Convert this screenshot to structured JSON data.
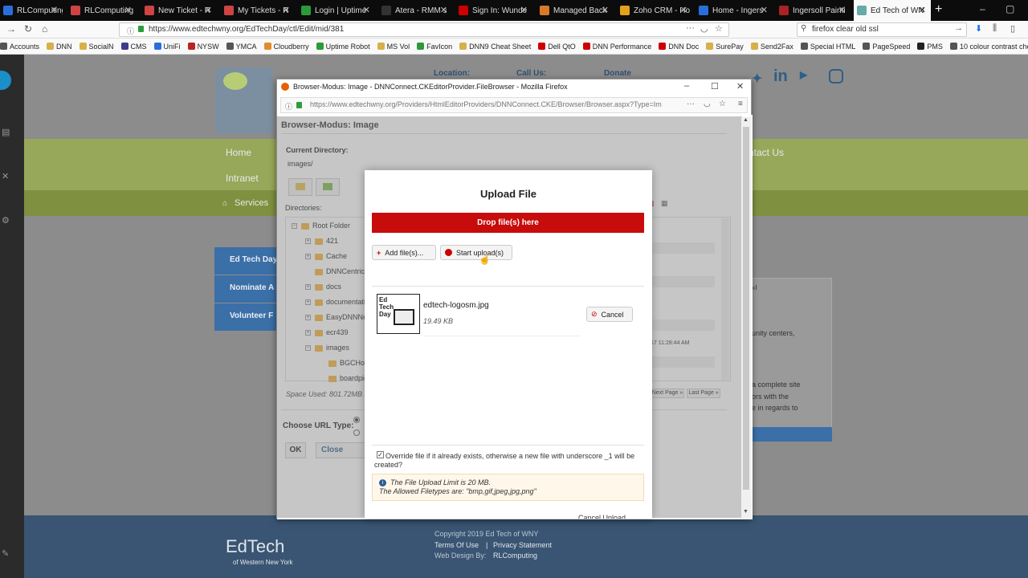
{
  "browser": {
    "tabs": [
      {
        "label": "RLComputing",
        "fav": "#2a6edb"
      },
      {
        "label": "RLComputing",
        "fav": "#c44"
      },
      {
        "label": "New Ticket - R",
        "fav": "#c44"
      },
      {
        "label": "My Tickets - R",
        "fav": "#c44"
      },
      {
        "label": "Login | Uptime",
        "fav": "#2b9b3a"
      },
      {
        "label": "Atera - RMM s",
        "fav": "#333"
      },
      {
        "label": "Sign In: Wunde",
        "fav": "#c00"
      },
      {
        "label": "Managed Back",
        "fav": "#d97a2b"
      },
      {
        "label": "Zoho CRM - Ho",
        "fav": "#e3a21a"
      },
      {
        "label": "Home - Ingers",
        "fav": "#2a6edb"
      },
      {
        "label": "Ingersoll Painti",
        "fav": "#a22"
      },
      {
        "label": "Ed Tech of WN",
        "fav": "#6aa"
      }
    ],
    "url": "https://www.edtechwny.org/EdTechDay/ctl/Edit/mid/381",
    "search": "firefox clear old ssl",
    "bookmarks": [
      "Accounts",
      "DNN",
      "SocialN",
      "CMS",
      "UniFi",
      "NYSW",
      "YMCA",
      "Cloudberry",
      "Uptime Robot",
      "MS Vol",
      "FavIcon",
      "DNN9 Cheat Sheet",
      "Dell QtO",
      "DNN Performance",
      "DNN Doc",
      "SurePay",
      "Send2Fax",
      "Special HTML",
      "PageSpeed",
      "PMS",
      "10 colour contrast che..."
    ]
  },
  "site": {
    "location_label": "Location:",
    "call_label": "Call Us:",
    "donate_label": "Donate",
    "nav_home": "Home",
    "nav_intranet": "Intranet",
    "nav_contact": "ntact Us",
    "services": "Services",
    "side_buttons": [
      "Ed Tech Day",
      "Nominate A",
      "Volunteer F"
    ],
    "side_text_1": "unity centers,",
    "side_text_2": "a complete site",
    "side_text_3": "ors with the",
    "side_text_4": "e in regards to",
    "footer_logo": "EdTech",
    "footer_logo_sub": "of Western New York",
    "copyright": "Copyright 2019 Ed Tech of WNY",
    "terms": "Terms Of Use",
    "privacy": "Privacy Statement",
    "web_design": "Web Design By:",
    "web_design_by": "RLComputing"
  },
  "popup": {
    "title": "Browser-Modus: Image - DNNConnect.CKEditorProvider.FileBrowser - Mozilla Firefox",
    "url": "https://www.edtechwny.org/Providers/HtmlEditorProviders/DNNConnect.CKE/Browser/Browser.aspx?Type=Im",
    "heading": "Browser-Modus: Image",
    "current_dir_label": "Current Directory:",
    "current_dir": "images/",
    "directories_label": "Directories:",
    "tree": [
      "Root Folder",
      "421",
      "Cache",
      "DNNCentric",
      "docs",
      "documentati",
      "EasyDNNNe",
      "ecr439",
      "images",
      "BGCHol",
      "boardpic"
    ],
    "space_used": "Space Used: 801.72MB c",
    "choose_url_label": "Choose URL Type:",
    "ok": "OK",
    "close_window": "Close Windo",
    "timestamp": "17 11:28:44 AM",
    "next_page": "Next Page »",
    "last_page": "Last Page »"
  },
  "upload": {
    "title": "Upload File",
    "drop": "Drop file(s) here",
    "add_files": "Add file(s)...",
    "start_upload": "Start upload(s)",
    "file_name": "edtech-logosm.jpg",
    "file_size": "19.49 KB",
    "thumb_text": "Ed Tech Day",
    "cancel": "Cancel",
    "override_text": "Override file if it already exists, otherwise a new file with underscore _1 will be created?",
    "limit_text": "The File Upload Limit is 20 MB.",
    "filetypes_text": "The Allowed Filetypes are: \"bmp,gif,jpeg,jpg,png\"",
    "cancel_upload": "Cancel Upload"
  }
}
